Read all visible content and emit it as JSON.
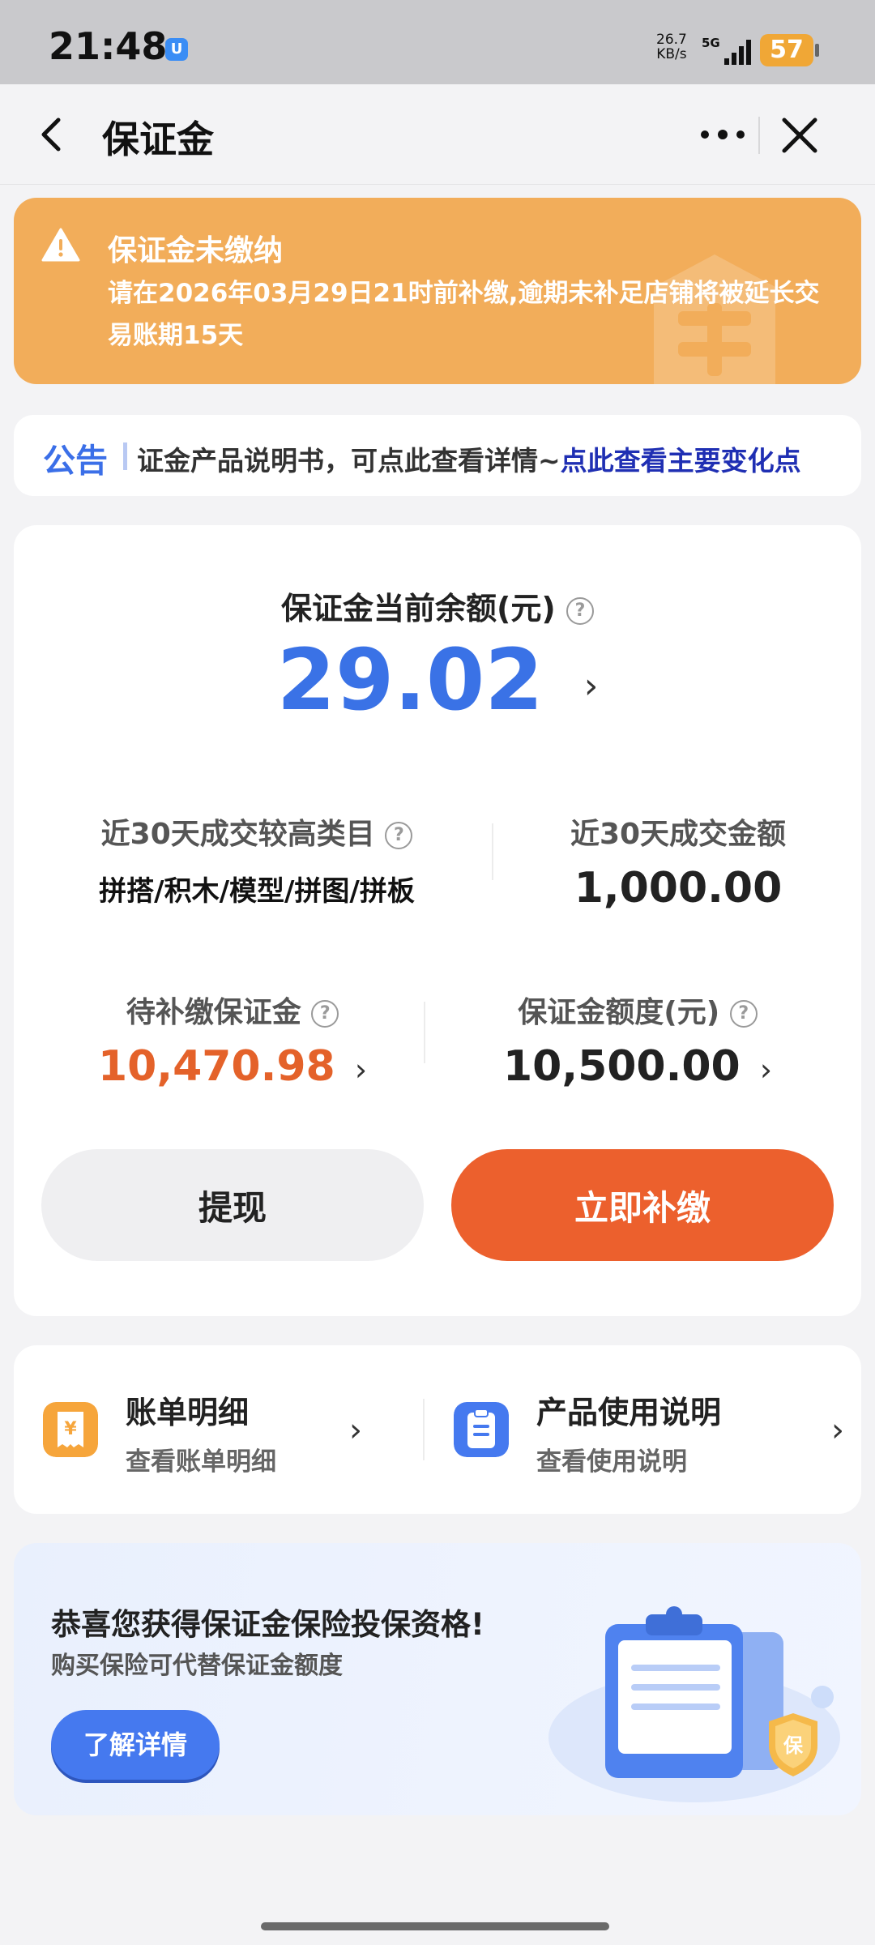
{
  "status_bar": {
    "time": "21:48",
    "app_badge": "U",
    "net_speed_value": "26.7",
    "net_speed_unit": "KB/s",
    "network": "5G",
    "battery": "57"
  },
  "nav": {
    "title": "保证金"
  },
  "alert": {
    "title": "保证金未缴纳",
    "text": "请在2026年03月29日21时前补缴,逾期未补足店铺将被延长交易账期15天"
  },
  "notice": {
    "tag": "公告",
    "text": "证金产品说明书，可点此查看详情~",
    "link": "点此查看主要变化点"
  },
  "balance": {
    "label": "保证金当前余额(元)",
    "value": "29.02"
  },
  "stats": {
    "top_category_label": "近30天成交较高类目",
    "top_category_value": "拼搭/积木/模型/拼图/拼板",
    "gmv_label": "近30天成交金额",
    "gmv_value": "1,000.00",
    "pending_label": "待补缴保证金",
    "pending_value": "10,470.98",
    "quota_label": "保证金额度(元)",
    "quota_value": "10,500.00"
  },
  "buttons": {
    "withdraw": "提现",
    "pay_now": "立即补缴"
  },
  "links": {
    "bill_title": "账单明细",
    "bill_sub": "查看账单明细",
    "guide_title": "产品使用说明",
    "guide_sub": "查看使用说明"
  },
  "insurance": {
    "headline": "恭喜您获得保证金保险投保资格!",
    "subline": "购买保险可代替保证金额度",
    "button": "了解详情",
    "shield_char": "保"
  },
  "colors": {
    "accent_blue": "#3a72e6",
    "accent_orange": "#ec602d",
    "alert_bg": "#f2ad5a"
  }
}
